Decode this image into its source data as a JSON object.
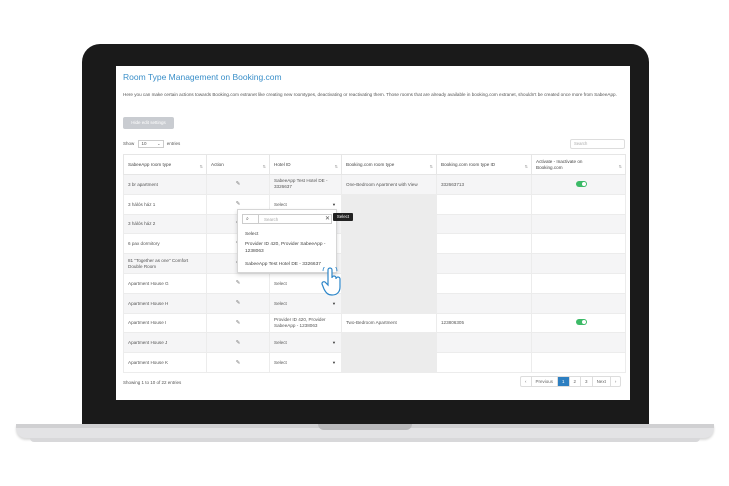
{
  "page": {
    "title": "Room Type Management on Booking.com",
    "description": "Here you can make certain actions towards Booking.com extranet like creating new roomtypes, deactivating or reactivating them. Those rooms that are already available in booking.com extranet, shouldn't be created once more from SabeeApp.",
    "hide_button": "Hide edit settings"
  },
  "table_controls": {
    "show_prefix": "Show",
    "entries_value": "10",
    "show_suffix": "entries",
    "search_placeholder": "Search"
  },
  "columns": [
    "SabeeApp room type",
    "Action",
    "Hotel ID",
    "Booking.com room type",
    "Booking.com room type ID",
    "Activate - Inactivate on Booking.com"
  ],
  "rows": [
    {
      "room": "3 br apartment",
      "hotel": "SabeeApp Test Hotel DE - 3326637",
      "bk_type": "One-Bedroom Apartment with View",
      "bk_id": "332663713",
      "toggle": true
    },
    {
      "room": "3 hálós ház 1",
      "hotel": "Select",
      "bk_type": "",
      "bk_id": "",
      "toggle": false
    },
    {
      "room": "3 hálós ház 2",
      "hotel": "",
      "bk_type": "",
      "bk_id": "",
      "toggle": false
    },
    {
      "room": "6 pax dormitory",
      "hotel": "",
      "bk_type": "",
      "bk_id": "",
      "toggle": false
    },
    {
      "room": "81 \"Together as one\" Comfort Double Room",
      "hotel": "",
      "bk_type": "",
      "bk_id": "",
      "toggle": false
    },
    {
      "room": "Apartment House G",
      "hotel": "Select",
      "bk_type": "",
      "bk_id": "",
      "toggle": false
    },
    {
      "room": "Apartment House H",
      "hotel": "Select",
      "bk_type": "",
      "bk_id": "",
      "toggle": false
    },
    {
      "room": "Apartment House I",
      "hotel": "Provider ID 420, Provider SabeeApp - 1238063",
      "bk_type": "Two-Bedroom Apartment",
      "bk_id": "123806305",
      "toggle": true
    },
    {
      "room": "Apartment House J",
      "hotel": "Select",
      "bk_type": "",
      "bk_id": "",
      "toggle": false
    },
    {
      "room": "Apartment House K",
      "hotel": "Select",
      "bk_type": "",
      "bk_id": "",
      "toggle": false
    }
  ],
  "footer": {
    "info": "Showing 1 to 10 of 22 entries",
    "pager": [
      "‹",
      "Previous",
      "1",
      "2",
      "3",
      "Next",
      "›"
    ]
  },
  "dropdown": {
    "search_placeholder": "Search",
    "tooltip": "Select",
    "options": [
      "Select",
      "Provider ID 420, Provider SabeeApp - 1238063",
      "SabeeApp Test Hotel DE - 3326637"
    ]
  }
}
